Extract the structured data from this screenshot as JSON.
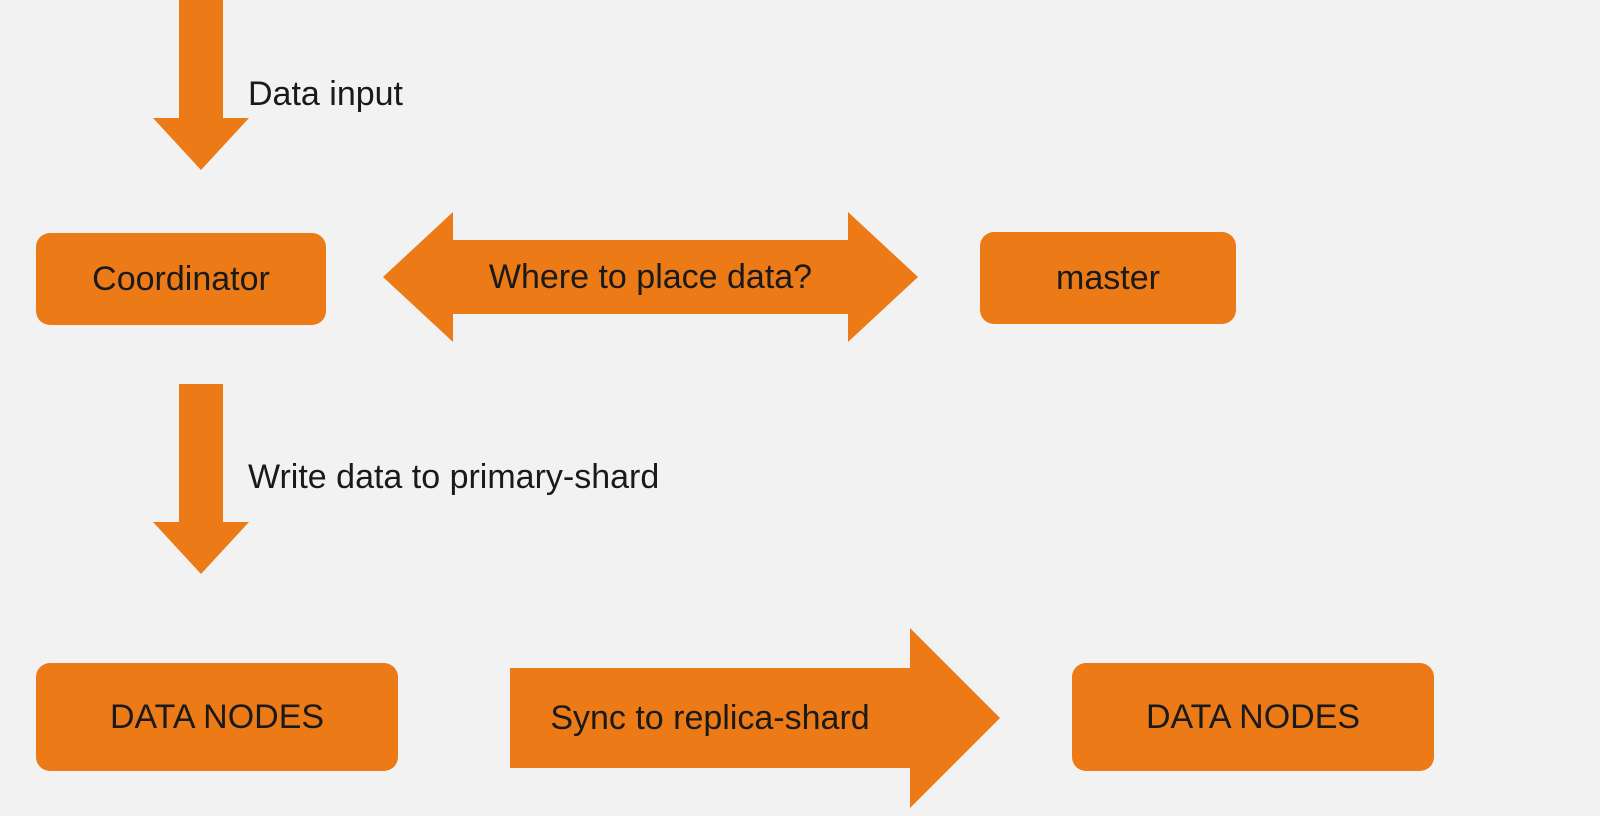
{
  "labels": {
    "data_input": "Data input",
    "write_primary": "Write data to primary-shard"
  },
  "nodes": {
    "coordinator": "Coordinator",
    "master": "master",
    "data_nodes_left": "DATA NODES",
    "data_nodes_right": "DATA NODES"
  },
  "arrows": {
    "where_to_place": "Where to place data?",
    "sync_replica": "Sync to replica-shard"
  },
  "colors": {
    "accent": "#ec7a16",
    "background": "#f2f2f2",
    "text": "#1a1a1a"
  }
}
